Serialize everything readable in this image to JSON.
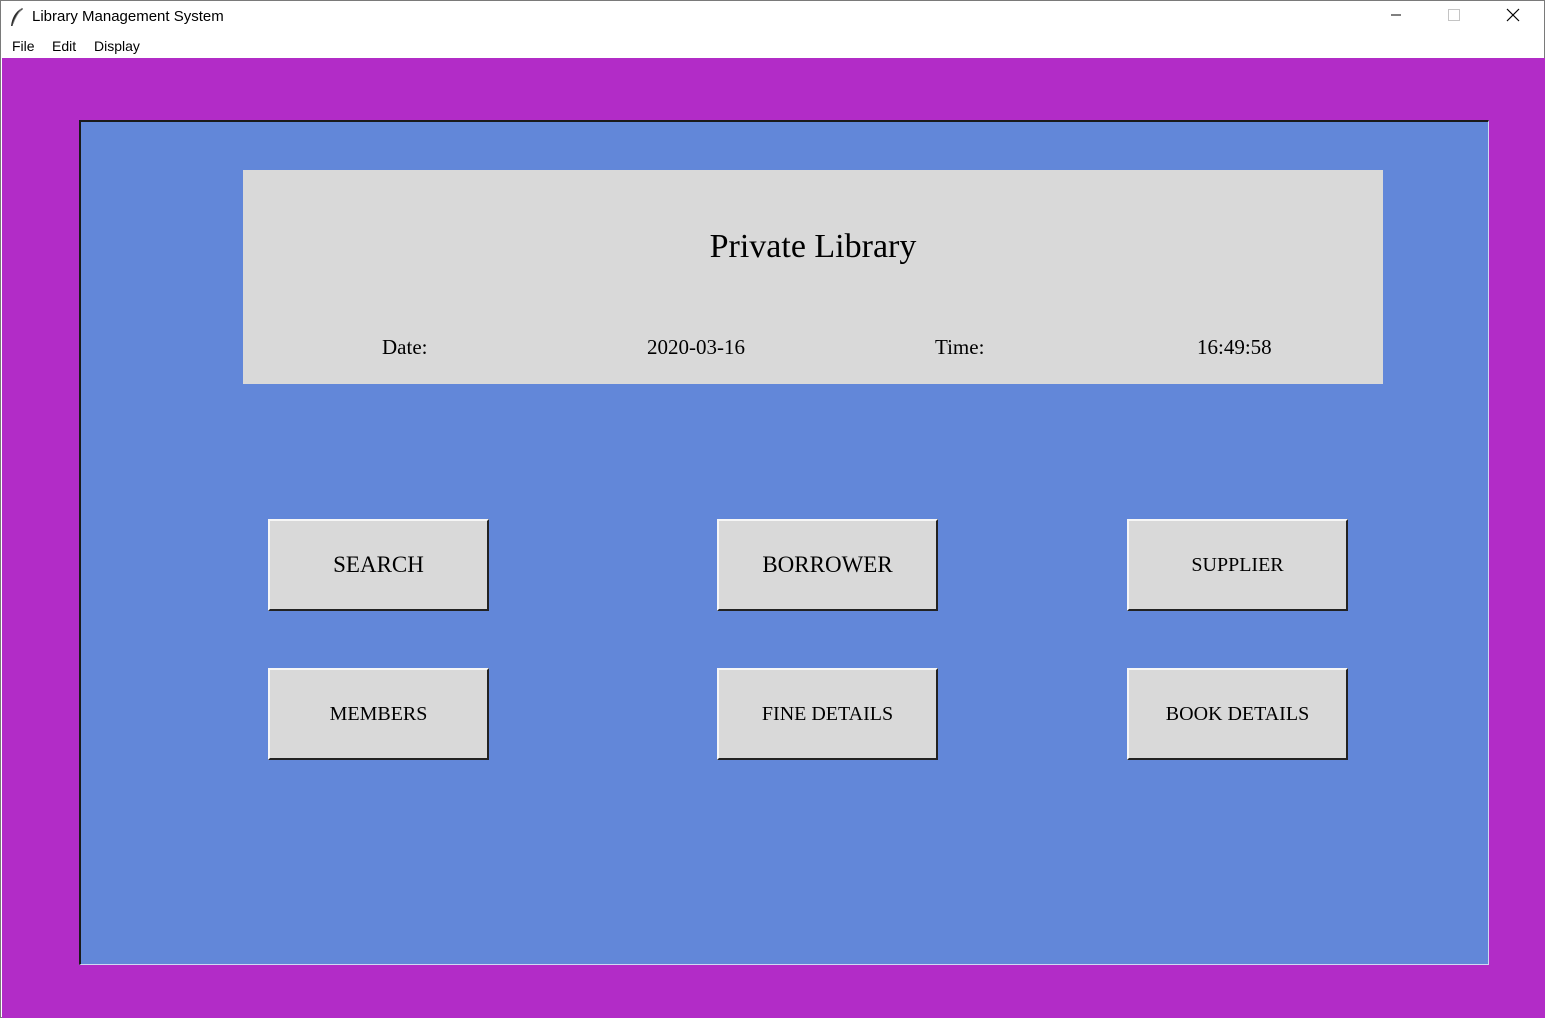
{
  "window": {
    "title": "Library Management System",
    "icons": {
      "app": "feather-icon",
      "minimize": "minimize-icon",
      "maximize": "maximize-icon",
      "close": "close-icon"
    }
  },
  "menu": {
    "items": [
      "File",
      "Edit",
      "Display"
    ]
  },
  "header": {
    "title": "Private Library",
    "date_label": "Date:",
    "date_value": "2020-03-16",
    "time_label": "Time:",
    "time_value": "16:49:58"
  },
  "buttons": {
    "search": "SEARCH",
    "borrower": "BORROWER",
    "supplier": "SUPPLIER",
    "members": "MEMBERS",
    "fine_details": "FINE DETAILS",
    "book_details": "BOOK DETAILS"
  },
  "colors": {
    "outer_background": "#b22cc7",
    "inner_background": "#6287d9",
    "panel_background": "#d9d9d9"
  }
}
